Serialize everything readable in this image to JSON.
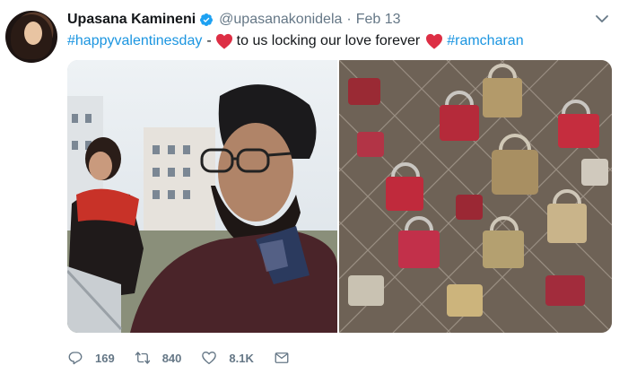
{
  "tweet": {
    "author_name": "Upasana Kamineni",
    "handle": "@upasanakonidela",
    "separator": "·",
    "date": "Feb 13",
    "text": {
      "hashtag1": "#happyvalentinesday",
      "dash": "-",
      "middle": "to us locking our love forever",
      "hashtag2": "#ramcharan"
    },
    "stats": {
      "replies": "169",
      "retweets": "840",
      "likes": "8.1K"
    }
  },
  "colors": {
    "link": "#1b95e0",
    "verified": "#1da1f2",
    "heart": "#e0245e",
    "muted": "#657786"
  },
  "icons": [
    "verified-badge-icon",
    "chevron-down-icon",
    "heart-emoji-icon",
    "reply-icon",
    "retweet-icon",
    "like-icon",
    "direct-message-icon"
  ]
}
